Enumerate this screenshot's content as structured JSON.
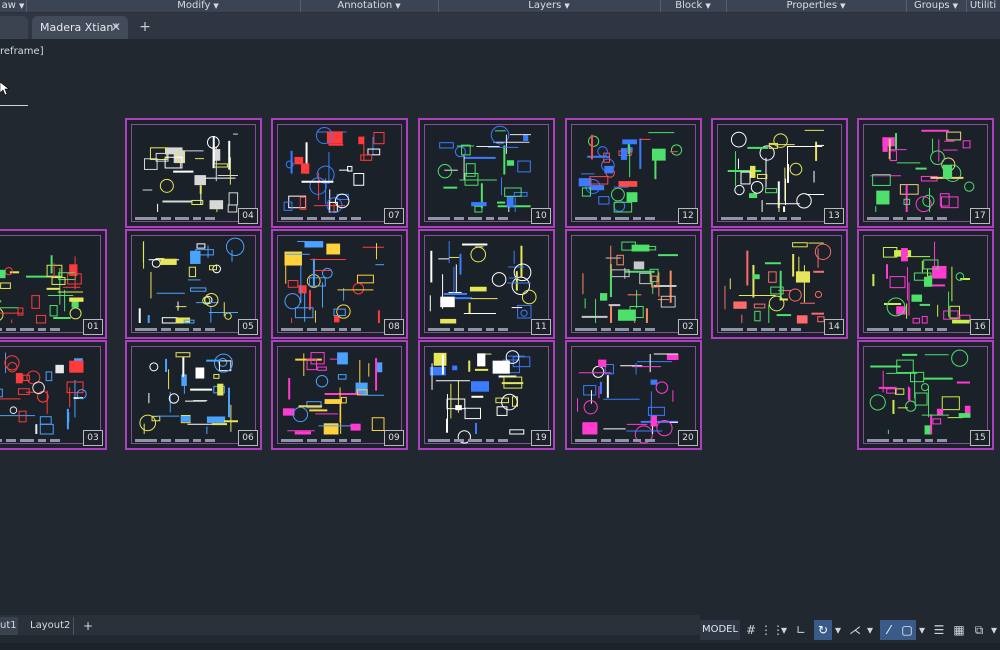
{
  "ribbon": {
    "panels": [
      {
        "label": "aw",
        "left": 0
      },
      {
        "label": "Modify",
        "left": 0
      },
      {
        "label": "Annotation",
        "left": 0
      },
      {
        "label": "Layers",
        "left": 0
      },
      {
        "label": "Block",
        "left": 0
      },
      {
        "label": "Properties",
        "left": 0
      },
      {
        "label": "Groups",
        "left": 0
      },
      {
        "label": "Utiliti",
        "left": 0
      }
    ]
  },
  "tabs": {
    "document": "Madera Xtian*",
    "close": "✕",
    "add": "+"
  },
  "viewport": {
    "label": "reframe]"
  },
  "sheets": [
    "01",
    "02",
    "03",
    "04",
    "05",
    "06",
    "07",
    "08",
    "09",
    "10",
    "11",
    "12",
    "13",
    "14",
    "15",
    "16",
    "17",
    "19",
    "20"
  ],
  "layout_tabs": {
    "tab1": "ut1",
    "tab2": "Layout2",
    "add": "+"
  },
  "status": {
    "model": "MODEL",
    "icons": [
      {
        "name": "grid-icon",
        "glyph": "#",
        "on": false
      },
      {
        "name": "snap-icon",
        "glyph": "⋮⋮",
        "on": false
      },
      {
        "name": "snap-dropdown-icon",
        "glyph": "▾",
        "on": false
      },
      {
        "name": "ortho-icon",
        "glyph": "∟",
        "on": false
      },
      {
        "name": "polar-icon",
        "glyph": "↻",
        "on": true
      },
      {
        "name": "polar-dropdown-icon",
        "glyph": "▾",
        "on": false
      },
      {
        "name": "isodraft-icon",
        "glyph": "⋌",
        "on": false
      },
      {
        "name": "isodraft-dropdown-icon",
        "glyph": "▾",
        "on": false
      },
      {
        "name": "object-track-icon",
        "glyph": "⁄",
        "on": true
      },
      {
        "name": "osnap-icon",
        "glyph": "▢",
        "on": true
      },
      {
        "name": "osnap-dropdown-icon",
        "glyph": "▾",
        "on": false
      },
      {
        "name": "lineweight-icon",
        "glyph": "☰",
        "on": false
      },
      {
        "name": "transparency-icon",
        "glyph": "▦",
        "on": false
      },
      {
        "name": "selection-cycling-icon",
        "glyph": "⧉",
        "on": false
      },
      {
        "name": "more-dropdown-icon",
        "glyph": "▾",
        "on": false
      }
    ]
  }
}
